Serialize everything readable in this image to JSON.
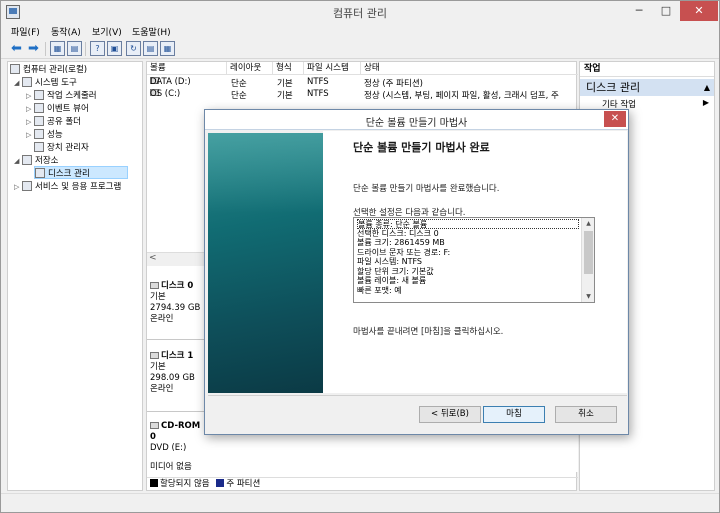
{
  "window": {
    "title": "컴퓨터 관리"
  },
  "window_buttons": {
    "minimize": "─",
    "maximize": "□",
    "close": "✕"
  },
  "menu": [
    "파일(F)",
    "동작(A)",
    "보기(V)",
    "도움말(H)"
  ],
  "toolbar": {
    "back_icon": "arrow-left-icon",
    "forward_icon": "arrow-right-icon",
    "buttons": [
      "▦",
      "▤",
      "?",
      "▣",
      "↻",
      "▤",
      "▦"
    ]
  },
  "tree": {
    "root": "컴퓨터 관리(로컬)",
    "system_tools": "시스템 도구",
    "task_scheduler": "작업 스케줄러",
    "event_viewer": "이벤트 뷰어",
    "shared_folders": "공유 폴더",
    "performance": "성능",
    "device_manager": "장치 관리자",
    "storage": "저장소",
    "disk_management": "디스크 관리",
    "services_apps": "서비스 및 응용 프로그램"
  },
  "volume_columns": [
    "볼륨",
    "레이아웃",
    "형식",
    "파일 시스템",
    "상태"
  ],
  "volumes": [
    {
      "name": "DATA (D:)",
      "layout": "단순",
      "type": "기본",
      "fs": "NTFS",
      "status": "정상 (주 파티션)"
    },
    {
      "name": "OS (C:)",
      "layout": "단순",
      "type": "기본",
      "fs": "NTFS",
      "status": "정상 (시스템, 부팅, 페이지 파일, 활성, 크래시 덤프, 주"
    }
  ],
  "scroll_left": "<",
  "disks": [
    {
      "name": "디스크 0",
      "type": "기본",
      "size": "2794.39 GB",
      "status": "온라인"
    },
    {
      "name": "디스크 1",
      "type": "기본",
      "size": "298.09 GB",
      "status": "온라인"
    },
    {
      "name": "CD-ROM 0",
      "type": "DVD (E:)",
      "size": "",
      "status": "미디어 없음"
    }
  ],
  "legend": {
    "unallocated": "할당되지 않음",
    "primary": "주 파티션",
    "unallocated_color": "#000000",
    "primary_color": "#1a2a8a"
  },
  "actions": {
    "header": "작업",
    "section": "디스크 관리",
    "section_arrow": "▲",
    "item": "기타 작업",
    "item_arrow": "▶"
  },
  "dialog": {
    "title": "단순 볼륨 만들기 마법사",
    "close": "✕",
    "heading": "단순 볼륨 만들기 마법사 완료",
    "completed_text": "단순 볼륨 만들기 마법사를 완료했습니다.",
    "settings_label": "선택한 설정은 다음과 같습니다.",
    "summary": [
      "볼륨 종류: 단순 볼륨",
      "선택한 디스크: 디스크 0",
      "볼륨 크기: 2861459 MB",
      "드라이브 문자 또는 경로: F:",
      "파일 시스템: NTFS",
      "할당 단위 크기: 기본값",
      "볼륨 레이블: 새 볼륨",
      "빠른 포맷: 예"
    ],
    "close_hint": "마법사를 끝내려면 [마침]을 클릭하십시오.",
    "back_button": "< 뒤로(B)",
    "finish_button": "마침",
    "cancel_button": "취소"
  }
}
